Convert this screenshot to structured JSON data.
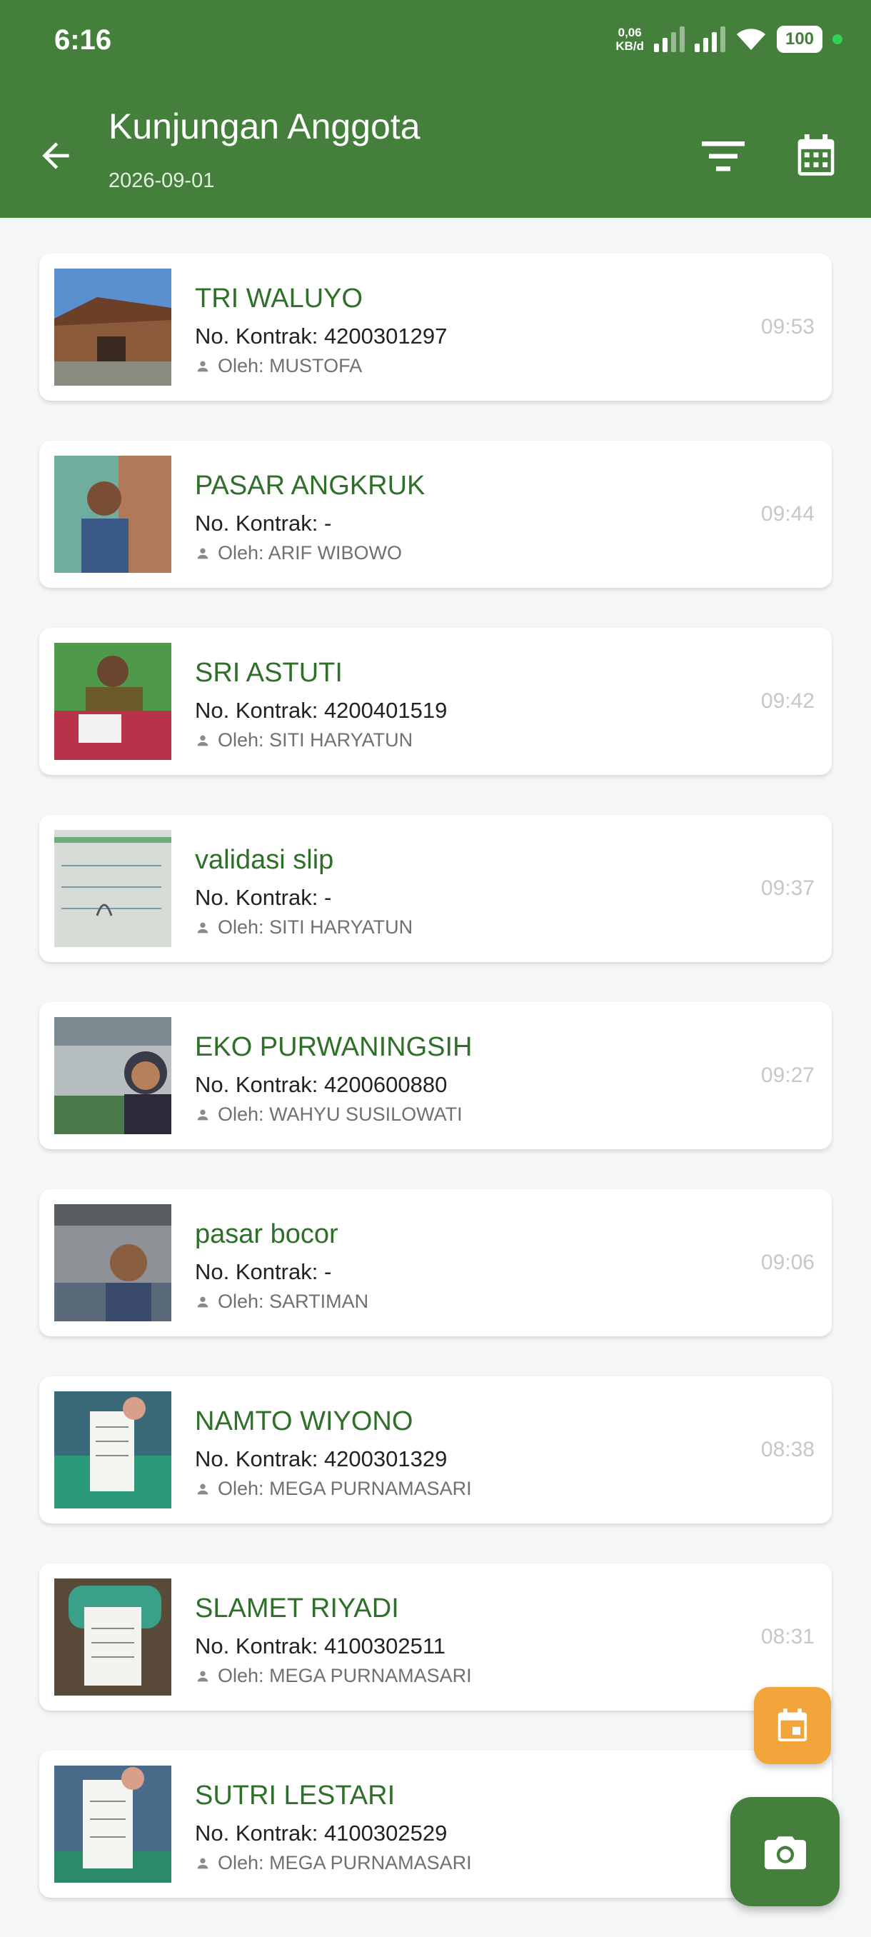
{
  "status": {
    "time": "6:16",
    "net_speed_value": "0,06",
    "net_speed_unit": "KB/d",
    "battery": "100"
  },
  "header": {
    "title": "Kunjungan Anggota",
    "date": "2026-09-01",
    "icons": [
      "arrow-back-icon",
      "filter-icon",
      "calendar-icon"
    ]
  },
  "contract_label": "No. Kontrak:",
  "by_label": "Oleh:",
  "visits": [
    {
      "name": "TRI WALUYO",
      "contract": "4200301297",
      "by": "MUSTOFA",
      "time": "09:53"
    },
    {
      "name": "PASAR ANGKRUK",
      "contract": "-",
      "by": "ARIF WIBOWO",
      "time": "09:44"
    },
    {
      "name": "SRI ASTUTI",
      "contract": "4200401519",
      "by": "SITI HARYATUN",
      "time": "09:42"
    },
    {
      "name": "validasi slip",
      "contract": "-",
      "by": "SITI HARYATUN",
      "time": "09:37"
    },
    {
      "name": "EKO PURWANINGSIH",
      "contract": "4200600880",
      "by": "WAHYU SUSILOWATI",
      "time": "09:27"
    },
    {
      "name": "pasar bocor",
      "contract": "-",
      "by": "SARTIMAN",
      "time": "09:06"
    },
    {
      "name": "NAMTO WIYONO",
      "contract": "4200301329",
      "by": "MEGA PURNAMASARI",
      "time": "08:38"
    },
    {
      "name": "SLAMET RIYADI",
      "contract": "4100302511",
      "by": "MEGA PURNAMASARI",
      "time": "08:31"
    },
    {
      "name": "SUTRI LESTARI",
      "contract": "4100302529",
      "by": "MEGA PURNAMASARI",
      "time": ""
    }
  ],
  "fabs": {
    "calendar": "calendar-icon",
    "camera": "camera-icon"
  },
  "colors": {
    "primary": "#44803c",
    "name_text": "#2f6f2a",
    "fab_orange": "#f3a43a",
    "background": "#f5f6f8"
  }
}
